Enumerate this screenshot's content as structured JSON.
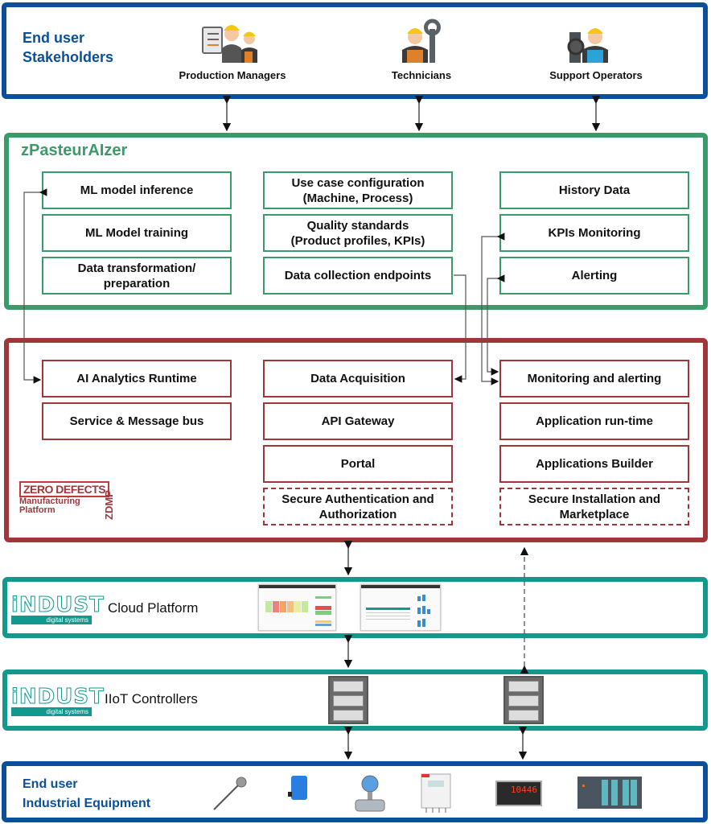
{
  "stakeholders": {
    "title": "End user\nStakeholders",
    "roles": [
      {
        "label": "Production Managers",
        "icon": "production-managers-icon"
      },
      {
        "label": "Technicians",
        "icon": "technician-icon"
      },
      {
        "label": "Support Operators",
        "icon": "support-operator-icon"
      }
    ]
  },
  "zpasteuraizer": {
    "title": "zPasteurAIzer",
    "col1": [
      "ML model inference",
      "ML Model training",
      "Data transformation/\npreparation"
    ],
    "col2": [
      "Use case configuration\n(Machine, Process)",
      "Quality standards\n(Product profiles, KPIs)",
      "Data collection endpoints"
    ],
    "col3": [
      "History Data",
      "KPIs Monitoring",
      "Alerting"
    ]
  },
  "zdmp": {
    "logo_main": "ZERO DEFECTS",
    "logo_sub": "Manufacturing\nPlatform",
    "logo_vertical": "ZDMP",
    "col1": [
      "AI Analytics Runtime",
      "Service & Message bus"
    ],
    "col2": [
      "Data Acquisition",
      "API Gateway",
      "Portal"
    ],
    "col2_dashed": "Secure Authentication and\nAuthorization",
    "col3": [
      "Monitoring and alerting",
      "Application run-time",
      "Applications Builder"
    ],
    "col3_dashed": "Secure Installation and\nMarketplace"
  },
  "cloud": {
    "logo_word": "iNDUST",
    "logo_sub": "digital systems",
    "label": "Cloud Platform"
  },
  "iiot": {
    "logo_word": "iNDUST",
    "logo_sub": "digital systems",
    "label": "IIoT Controllers"
  },
  "equipment": {
    "title": "End user\nIndustrial Equipment",
    "devices": [
      "temperature-probe-icon",
      "photoelectric-sensor-icon",
      "flow-meter-icon",
      "analyzer-unit-icon",
      "digital-panel-meter-icon",
      "plc-rack-icon"
    ],
    "panel_meter_reading": "10446"
  },
  "colors": {
    "blue": "#0a4f9c",
    "green": "#3a9a6a",
    "red": "#9e363a",
    "teal": "#11998e"
  }
}
